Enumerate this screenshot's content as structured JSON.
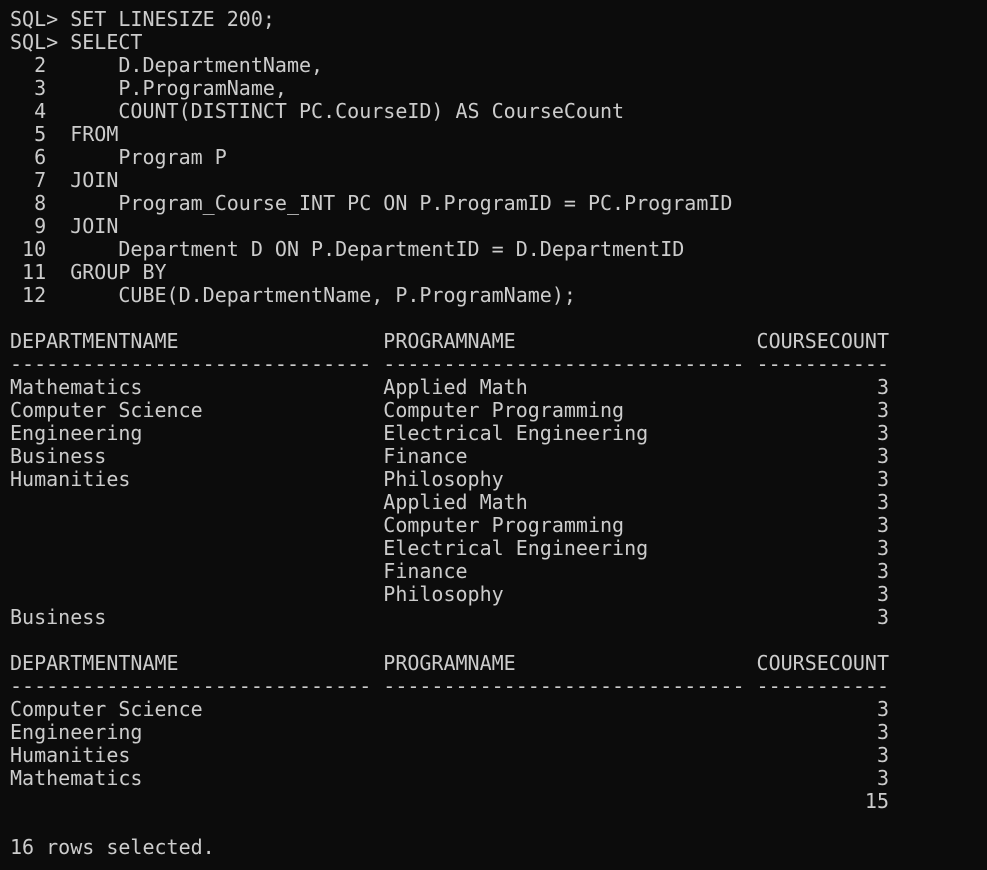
{
  "terminal": {
    "lines": [
      "SQL> SET LINESIZE 200;",
      "SQL> SELECT",
      "  2      D.DepartmentName,",
      "  3      P.ProgramName,",
      "  4      COUNT(DISTINCT PC.CourseID) AS CourseCount",
      "  5  FROM",
      "  6      Program P",
      "  7  JOIN",
      "  8      Program_Course_INT PC ON P.ProgramID = PC.ProgramID",
      "  9  JOIN",
      " 10      Department D ON P.DepartmentID = D.DepartmentID",
      " 11  GROUP BY",
      " 12      CUBE(D.DepartmentName, P.ProgramName);",
      "",
      "DEPARTMENTNAME                 PROGRAMNAME                    COURSECOUNT",
      "------------------------------ ------------------------------ -----------",
      "Mathematics                    Applied Math                             3",
      "Computer Science               Computer Programming                     3",
      "Engineering                    Electrical Engineering                   3",
      "Business                       Finance                                  3",
      "Humanities                     Philosophy                               3",
      "                               Applied Math                             3",
      "                               Computer Programming                     3",
      "                               Electrical Engineering                   3",
      "                               Finance                                  3",
      "                               Philosophy                               3",
      "Business                                                                3",
      "",
      "DEPARTMENTNAME                 PROGRAMNAME                    COURSECOUNT",
      "------------------------------ ------------------------------ -----------",
      "Computer Science                                                        3",
      "Engineering                                                             3",
      "Humanities                                                              3",
      "Mathematics                                                             3",
      "                                                                       15",
      "",
      "16 rows selected."
    ]
  }
}
